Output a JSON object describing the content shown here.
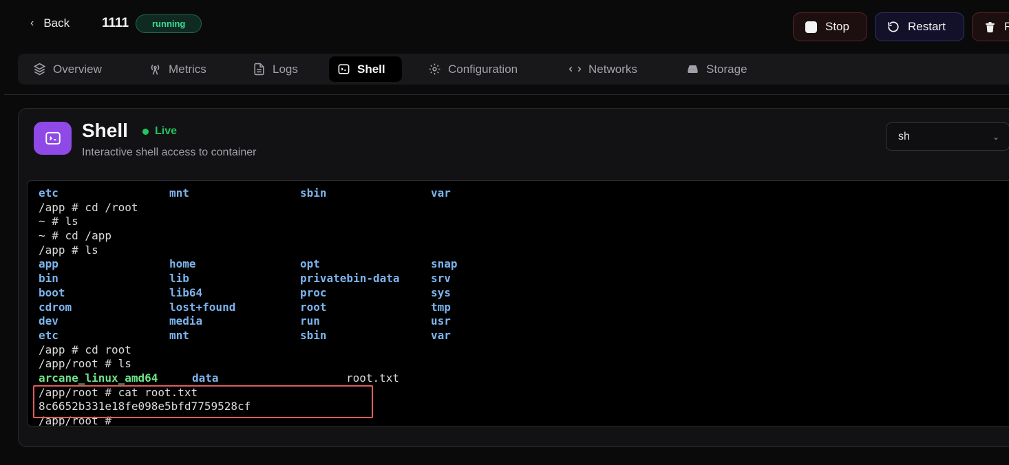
{
  "header": {
    "back_label": "Back",
    "container_name": "1111",
    "status": "running",
    "buttons": {
      "stop": "Stop",
      "restart": "Restart",
      "remove": "R"
    }
  },
  "tabs": [
    {
      "label": "Overview",
      "icon": "layers-icon"
    },
    {
      "label": "Metrics",
      "icon": "antenna-icon"
    },
    {
      "label": "Logs",
      "icon": "file-text-icon"
    },
    {
      "label": "Shell",
      "icon": "terminal-icon",
      "active": true
    },
    {
      "label": "Configuration",
      "icon": "gear-icon"
    },
    {
      "label": "Networks",
      "icon": "arrows-horizontal-icon"
    },
    {
      "label": "Storage",
      "icon": "hard-drive-icon"
    }
  ],
  "shell": {
    "title": "Shell",
    "live_label": "Live",
    "description": "Interactive shell access to container",
    "shell_select_value": "sh"
  },
  "terminal": {
    "lines": [
      {
        "type": "cols",
        "cells": [
          "etc",
          "mnt",
          "sbin",
          "var"
        ]
      },
      {
        "type": "text",
        "text": "/app # cd /root"
      },
      {
        "type": "text",
        "text": "~ # ls"
      },
      {
        "type": "text",
        "text": "~ # cd /app"
      },
      {
        "type": "text",
        "text": "/app # ls"
      },
      {
        "type": "cols",
        "cells": [
          "app",
          "home",
          "opt",
          "snap"
        ]
      },
      {
        "type": "cols",
        "cells": [
          "bin",
          "lib",
          "privatebin-data",
          "srv"
        ]
      },
      {
        "type": "cols",
        "cells": [
          "boot",
          "lib64",
          "proc",
          "sys"
        ]
      },
      {
        "type": "cols",
        "cells": [
          "cdrom",
          "lost+found",
          "root",
          "tmp"
        ]
      },
      {
        "type": "cols",
        "cells": [
          "dev",
          "media",
          "run",
          "usr"
        ]
      },
      {
        "type": "cols",
        "cells": [
          "etc",
          "mnt",
          "sbin",
          "var"
        ]
      },
      {
        "type": "text",
        "text": "/app # cd root"
      },
      {
        "type": "text",
        "text": "/app/root # ls"
      },
      {
        "type": "ls3",
        "cells": [
          "arcane_linux_amd64",
          "data",
          "root.txt"
        ]
      },
      {
        "type": "text",
        "text": "/app/root # cat root.txt"
      },
      {
        "type": "text",
        "text": "8c6652b331e18fe098e5bfd7759528cf"
      },
      {
        "type": "text",
        "text": "/app/root # _"
      }
    ]
  },
  "colors": {
    "accent_purple": "#8e49e6",
    "status_green": "#3ddc97",
    "live_green": "#22c55e",
    "dir_blue": "#7cb4ee",
    "exe_green": "#6ee38a",
    "highlight_red": "#e35b5b"
  }
}
